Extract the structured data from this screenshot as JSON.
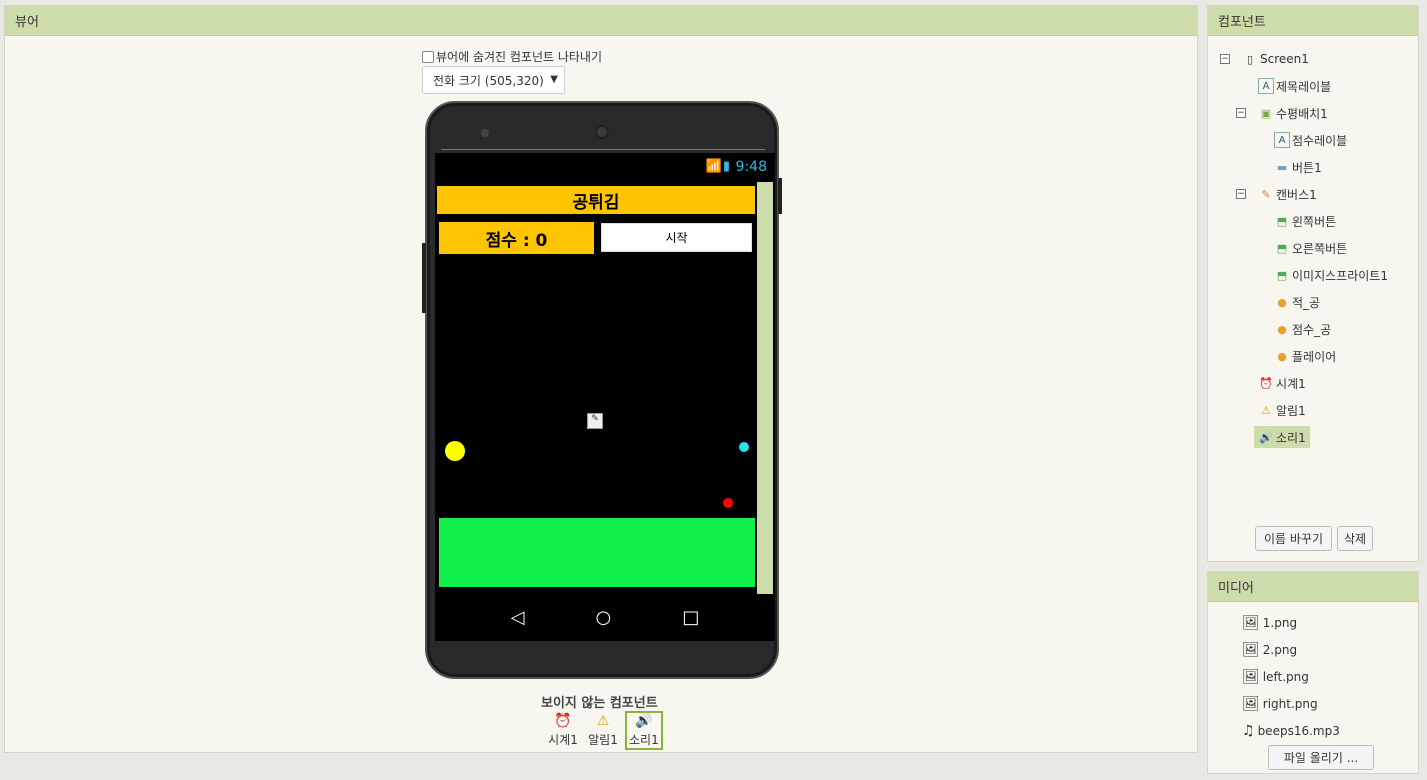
{
  "viewer": {
    "title": "뷰어",
    "hidden_checkbox_label": "뷰어에 숨겨진 컴포넌트 나타내기",
    "size_select": "전화 크기 (505,320)",
    "nonvisible_title": "보이지 않는 컴포넌트",
    "nonvisible": [
      {
        "label": "시계1",
        "icon": "clock-icon"
      },
      {
        "label": "알림1",
        "icon": "warning-icon"
      },
      {
        "label": "소리1",
        "icon": "speaker-icon"
      }
    ]
  },
  "phone": {
    "time": "9:48",
    "title_label": "공튀김",
    "score_label": "점수 : 0",
    "start_button": "시작"
  },
  "components": {
    "title": "컴포넌트",
    "items": [
      {
        "label": "Screen1",
        "icon": "screen-icon"
      },
      {
        "label": "제목레이블",
        "icon": "label-icon"
      },
      {
        "label": "수평배치1",
        "icon": "arrangement-icon"
      },
      {
        "label": "점수레이블",
        "icon": "label-icon"
      },
      {
        "label": "버튼1",
        "icon": "button-icon"
      },
      {
        "label": "캔버스1",
        "icon": "canvas-icon"
      },
      {
        "label": "왼쪽버튼",
        "icon": "imagesprite-icon"
      },
      {
        "label": "오른쪽버튼",
        "icon": "imagesprite-icon"
      },
      {
        "label": "이미지스프라이트1",
        "icon": "imagesprite-icon"
      },
      {
        "label": "적_공",
        "icon": "ball-icon"
      },
      {
        "label": "점수_공",
        "icon": "ball-icon"
      },
      {
        "label": "플레이어",
        "icon": "ball-icon"
      },
      {
        "label": "시계1",
        "icon": "clock-icon"
      },
      {
        "label": "알림1",
        "icon": "warning-icon"
      },
      {
        "label": "소리1",
        "icon": "speaker-icon"
      }
    ],
    "rename_button": "이름 바꾸기",
    "delete_button": "삭제"
  },
  "media": {
    "title": "미디어",
    "files": [
      {
        "label": "1.png",
        "icon": "image-icon"
      },
      {
        "label": "2.png",
        "icon": "image-icon"
      },
      {
        "label": "left.png",
        "icon": "image-icon"
      },
      {
        "label": "right.png",
        "icon": "image-icon"
      },
      {
        "label": "beeps16.mp3",
        "icon": "music-icon"
      }
    ],
    "upload_button": "파일 올리기 ..."
  },
  "colors": {
    "header_green": "#cddcab",
    "title_bar": "#ffc400",
    "pad_green": "#11f04a",
    "player_ball": "#ffff00",
    "score_ball": "#22e5f0",
    "enemy_ball": "#ff0000"
  }
}
